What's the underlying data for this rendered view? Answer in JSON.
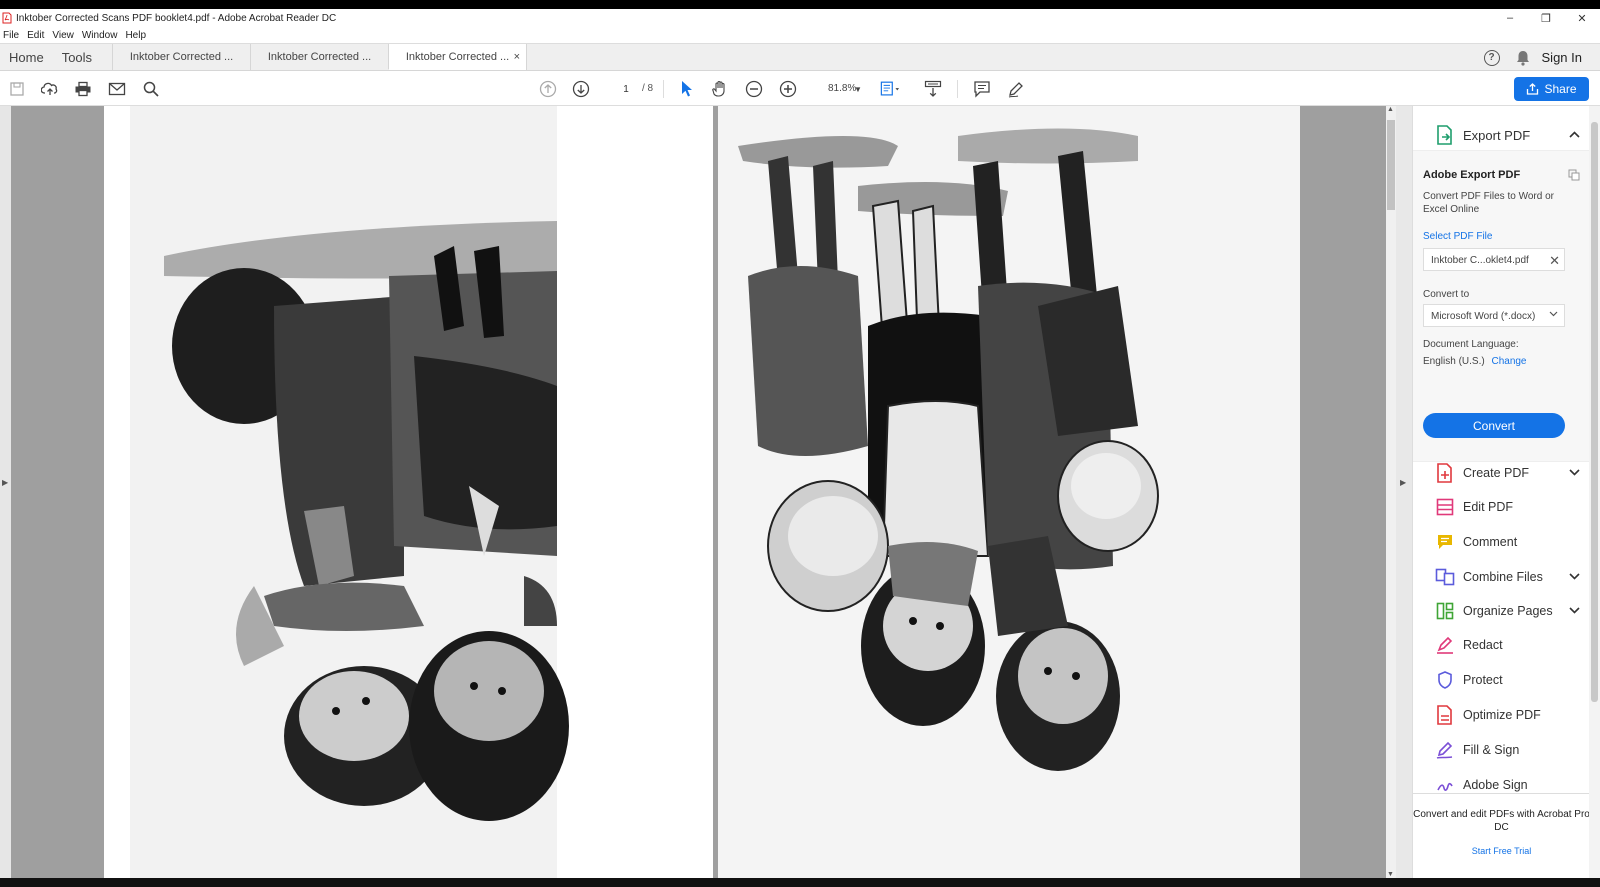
{
  "window": {
    "title": "Inktober Corrected Scans PDF booklet4.pdf - Adobe Acrobat Reader DC",
    "minimize": "–",
    "restore": "❐",
    "close": "✕"
  },
  "menu": [
    "File",
    "Edit",
    "View",
    "Window",
    "Help"
  ],
  "tabs": {
    "home": "Home",
    "tools": "Tools",
    "documents": [
      {
        "label": "Inktober Corrected ...",
        "active": false
      },
      {
        "label": "Inktober Corrected ...",
        "active": false
      },
      {
        "label": "Inktober Corrected ...",
        "active": true,
        "close": "×"
      }
    ],
    "help_icon": "?",
    "sign_in": "Sign In"
  },
  "toolbar": {
    "page_current": "1",
    "page_total": "/ 8",
    "zoom": "81.8%",
    "share_label": "Share",
    "accent": "#1473e6"
  },
  "right_panel": {
    "export_pdf": {
      "label": "Export PDF",
      "title": "Adobe Export PDF",
      "description": "Convert PDF Files to Word or Excel Online",
      "select_label": "Select PDF File",
      "file_name": "Inktober C...oklet4.pdf",
      "convert_to_label": "Convert to",
      "convert_to_value": "Microsoft Word (*.docx)",
      "language_label": "Document Language:",
      "language_value": "English (U.S.)",
      "change_link": "Change",
      "convert_button": "Convert"
    },
    "tools": [
      {
        "label": "Create PDF",
        "icon": "create-pdf-icon",
        "expandable": true,
        "color": "#e0393e"
      },
      {
        "label": "Edit PDF",
        "icon": "edit-pdf-icon",
        "expandable": false,
        "color": "#e0397a"
      },
      {
        "label": "Comment",
        "icon": "comment-icon",
        "expandable": false,
        "color": "#e8b700"
      },
      {
        "label": "Combine Files",
        "icon": "combine-files-icon",
        "expandable": true,
        "color": "#5b5bdc"
      },
      {
        "label": "Organize Pages",
        "icon": "organize-pages-icon",
        "expandable": true,
        "color": "#3fa535"
      },
      {
        "label": "Redact",
        "icon": "redact-icon",
        "expandable": false,
        "color": "#e0397a"
      },
      {
        "label": "Protect",
        "icon": "protect-icon",
        "expandable": false,
        "color": "#5b5bdc"
      },
      {
        "label": "Optimize PDF",
        "icon": "optimize-pdf-icon",
        "expandable": false,
        "color": "#e0393e"
      },
      {
        "label": "Fill & Sign",
        "icon": "fill-sign-icon",
        "expandable": false,
        "color": "#7b4fd6"
      },
      {
        "label": "Adobe Sign",
        "icon": "adobe-sign-icon",
        "expandable": false,
        "color": "#7b4fd6"
      }
    ],
    "promo": "Convert and edit PDFs with Acrobat Pro DC",
    "trial_link": "Start Free Trial"
  }
}
